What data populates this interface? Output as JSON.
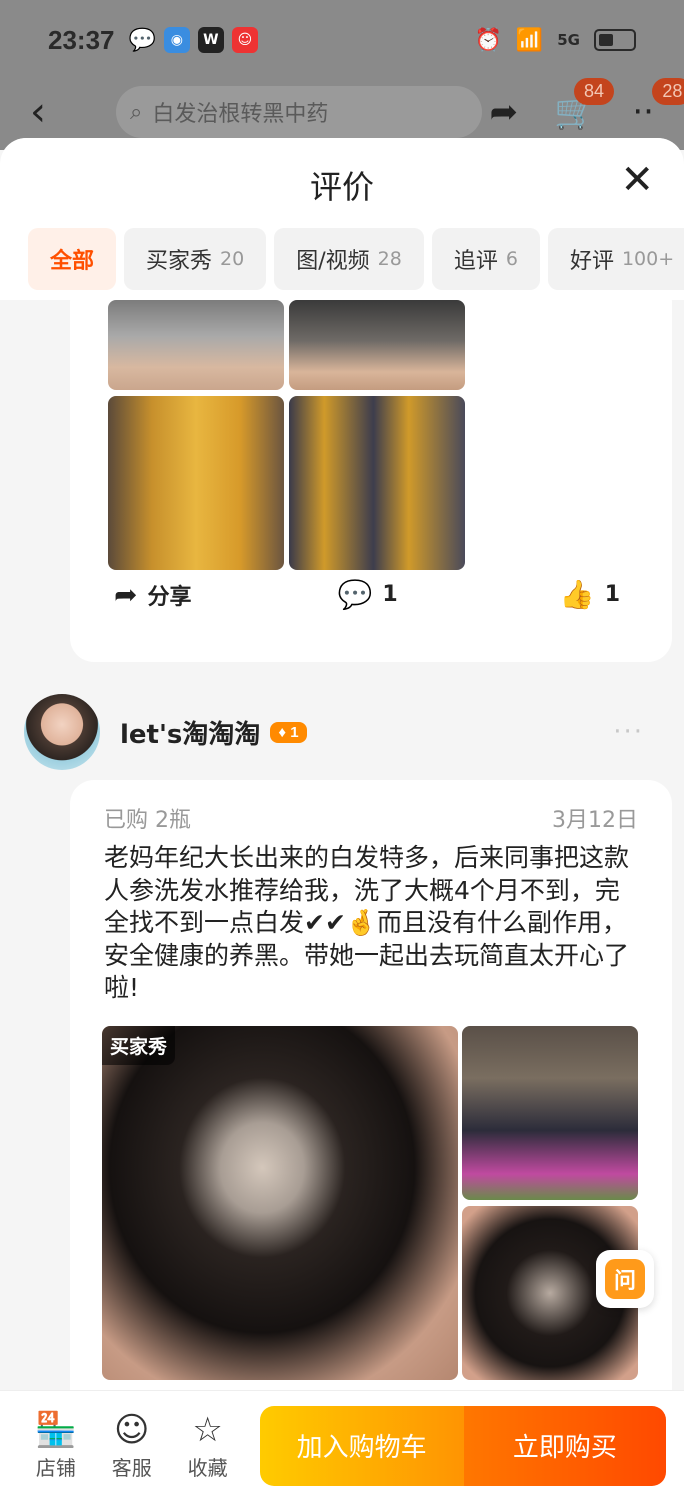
{
  "status_bar": {
    "time": "23:37",
    "network": "5G"
  },
  "top_nav": {
    "search_placeholder": "白发治根转黑中药",
    "cart_badge": "84",
    "message_badge": "28"
  },
  "sheet": {
    "title": "评价",
    "tabs": [
      {
        "label": "全部",
        "count": ""
      },
      {
        "label": "买家秀",
        "count": "20"
      },
      {
        "label": "图/视频",
        "count": "28"
      },
      {
        "label": "追评",
        "count": "6"
      },
      {
        "label": "好评",
        "count": "100+"
      }
    ]
  },
  "review1": {
    "share_label": "分享",
    "comment_count": "1",
    "like_count": "1"
  },
  "review2": {
    "username": "let's淘淘淘",
    "level": "1",
    "purchase": "已购 2瓶",
    "date": "3月12日",
    "text": "老妈年纪大长出来的白发特多，后来同事把这款人参洗发水推荐给我，洗了大概4个月不到，完全找不到一点白发✔✔🤞而且没有什么副作用，安全健康的养黑。带她一起出去玩简直太开心了啦!",
    "photo_tag": "买家秀"
  },
  "ask_label": "问",
  "bottom_bar": {
    "shop_label": "店铺",
    "service_label": "客服",
    "favorite_label": "收藏",
    "add_cart_label": "加入购物车",
    "buy_now_label": "立即购买"
  },
  "colors": {
    "accent": "#ff5000",
    "cart_button": "#ffb000",
    "buy_button": "#ff5a00"
  }
}
